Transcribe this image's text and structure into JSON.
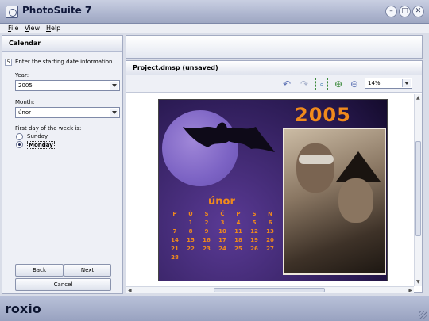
{
  "window": {
    "title": "PhotoSuite 7",
    "min_glyph": "–",
    "max_glyph": "□",
    "close_glyph": "✕"
  },
  "menu": {
    "items": [
      "File",
      "View",
      "Help"
    ]
  },
  "left_panel": {
    "title": "Calendar",
    "step_number": "5",
    "hint": "Enter the starting date information.",
    "year_label": "Year:",
    "year_value": "2005",
    "month_label": "Month:",
    "month_value": "únor",
    "week_label": "First day of the week is:",
    "radio_sunday": "Sunday",
    "radio_monday": "Monday",
    "back": "Back",
    "next": "Next",
    "cancel": "Cancel"
  },
  "right_panel": {
    "title": "Project.dmsp (unsaved)",
    "zoom_value": "14%"
  },
  "calendar_card": {
    "year": "2005",
    "month": "únor",
    "weekdays": [
      "P",
      "Ú",
      "S",
      "Č",
      "P",
      "S",
      "N"
    ],
    "weeks": [
      [
        "",
        "1",
        "2",
        "3",
        "4",
        "5",
        "6"
      ],
      [
        "7",
        "8",
        "9",
        "10",
        "11",
        "12",
        "13"
      ],
      [
        "14",
        "15",
        "16",
        "17",
        "18",
        "19",
        "20"
      ],
      [
        "21",
        "22",
        "23",
        "24",
        "25",
        "26",
        "27"
      ],
      [
        "28",
        "",
        "",
        "",
        "",
        "",
        ""
      ]
    ]
  },
  "status": {
    "logo": "roxio"
  },
  "colors": {
    "accent_orange": "#f08a1c",
    "card_purple": "#5a3a95"
  },
  "icons": [
    "undo-icon",
    "redo-icon",
    "zoom-select-icon",
    "zoom-in-icon",
    "zoom-out-icon"
  ]
}
